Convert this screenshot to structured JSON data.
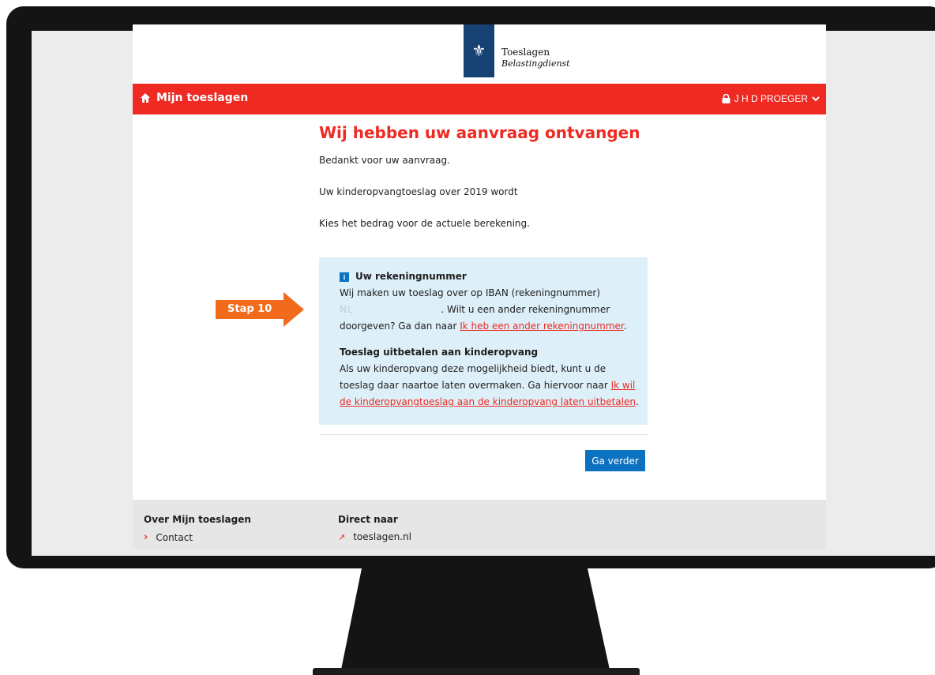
{
  "brand": {
    "name": "Toeslagen",
    "sub": "Belastingdienst",
    "crest_icon": "coat-of-arms"
  },
  "nav": {
    "home_label": "Mijn toeslagen",
    "user_label": "J H D PROEGER",
    "accent": "#ee2a22"
  },
  "main": {
    "title": "Wij hebben uw aanvraag ontvangen",
    "p1": "Bedankt voor uw aanvraag.",
    "p2": "Uw kinderopvangtoeslag over 2019 wordt",
    "p3": "Kies het bedrag voor de actuele berekening."
  },
  "info": {
    "icon": "i",
    "heading": "Uw rekeningnummer",
    "line1": "Wij maken uw toeslag over op IBAN (rekeningnummer)",
    "iban_masked": "NL                       ",
    "line2": ". Wilt u een ander rekeningnummer",
    "line3": "doorgeven? Ga dan naar ",
    "link1": "Ik heb een ander rekeningnummer",
    "period": ".",
    "heading2": "Toeslag uitbetalen aan kinderopvang",
    "body2a": "Als uw kinderopvang deze mogelijkheid biedt, kunt u de toeslag daar naartoe laten overmaken. Ga hiervoor naar ",
    "link2": "Ik wil de kinderopvangtoeslag aan de kinderopvang laten uitbetalen",
    "period2": "."
  },
  "actions": {
    "continue": "Ga verder"
  },
  "footer": {
    "col1_title": "Over Mijn toeslagen",
    "col1_item": "Contact",
    "col2_title": "Direct naar",
    "col2_item": "toeslagen.nl"
  },
  "annotation": {
    "step": "Stap 10"
  }
}
